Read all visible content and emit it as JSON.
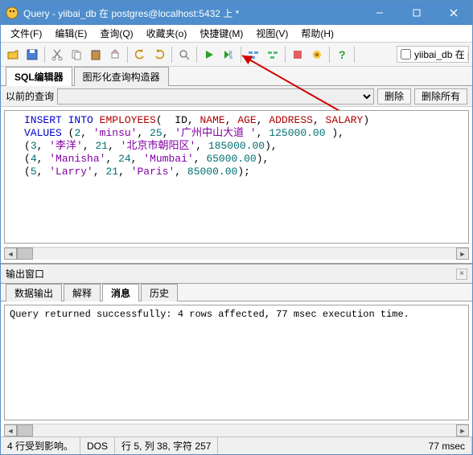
{
  "window": {
    "title": "Query - yiibai_db 在 postgres@localhost:5432 上 *"
  },
  "menus": [
    "文件(F)",
    "编辑(E)",
    "查询(Q)",
    "收藏夹(o)",
    "快捷键(M)",
    "视图(V)",
    "帮助(H)"
  ],
  "toolbar": {
    "db_checkbox_label": "yiibai_db 在 p"
  },
  "tabs": {
    "sql_editor": "SQL编辑器",
    "graphical": "图形化查询构造器"
  },
  "history": {
    "label": "以前的查询",
    "delete": "删除",
    "delete_all": "删除所有"
  },
  "sql": {
    "l1_a": "INSERT INTO",
    "l1_b": "EMPLOYEES",
    "l1_c": "(  ID",
    "l1_d": "NAME",
    "l1_e": "AGE",
    "l1_f": "ADDRESS",
    "l1_g": "SALARY",
    "l1_h": ")",
    "l2_a": "VALUES",
    "l2_b": "(",
    "l2_c": "2",
    "l2_d": "'minsu'",
    "l2_e": "25",
    "l2_f": "'广州中山大道 '",
    "l2_g": "125000.00",
    "l2_h": " ),",
    "l3_a": "(",
    "l3_b": "3",
    "l3_c": "'李洋'",
    "l3_d": "21",
    "l3_e": "'北京市朝阳区'",
    "l3_f": "185000.00",
    "l3_g": "),",
    "l4_a": "(",
    "l4_b": "4",
    "l4_c": "'Manisha'",
    "l4_d": "24",
    "l4_e": "'Mumbai'",
    "l4_f": "65000.00",
    "l4_g": "),",
    "l5_a": "(",
    "l5_b": "5",
    "l5_c": "'Larry'",
    "l5_d": "21",
    "l5_e": "'Paris'",
    "l5_f": "85000.00",
    "l5_g": ");"
  },
  "output_pane": {
    "title": "输出窗口"
  },
  "output_tabs": {
    "data": "数据输出",
    "explain": "解释",
    "messages": "消息",
    "history": "历史"
  },
  "message": "Query returned successfully: 4 rows affected, 77 msec execution time.",
  "status": {
    "rows": "4 行受到影响。",
    "enc": "DOS",
    "pos": "行 5, 列 38, 字符 257",
    "time": "77 msec"
  }
}
